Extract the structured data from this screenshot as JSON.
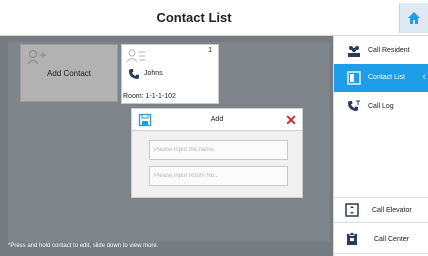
{
  "header": {
    "title": "Contact List",
    "home_icon": "home-icon"
  },
  "grid": {
    "add_tile_label": "Add Contact",
    "contact": {
      "number": "1",
      "name": "Johns",
      "room": "Room: 1-1-1-102"
    }
  },
  "dialog": {
    "title": "Add",
    "name_placeholder": "Please input the name.",
    "room_placeholder": "Please input Room No.."
  },
  "hint": "*Press and hold contact to edit, slide down to view more.",
  "sidebar": {
    "call_resident": "Call Resident",
    "contact_list": "Contact List",
    "call_log": "Call Log",
    "call_elevator": "Call Elevator",
    "call_center": "Call Center"
  },
  "colors": {
    "accent": "#1e9ee8",
    "close": "#d52b2b",
    "overlay": "#767c82"
  }
}
